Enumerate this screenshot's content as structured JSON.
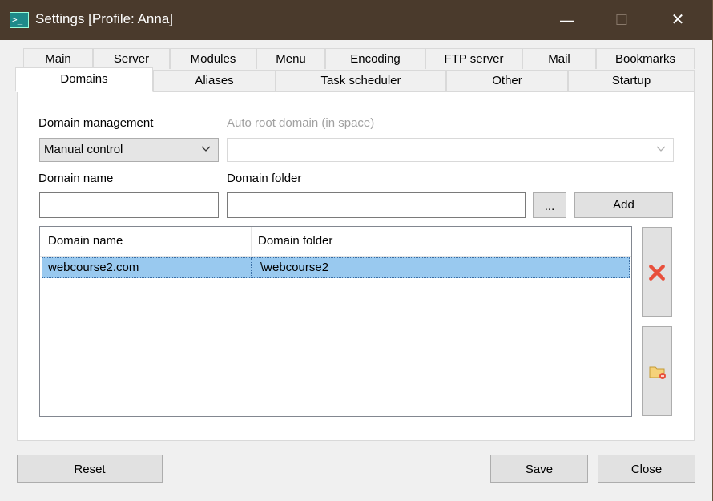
{
  "window": {
    "title": "Settings [Profile: Anna]",
    "controls": {
      "minimize": "—",
      "maximize": "☐",
      "close": "✕"
    }
  },
  "tabs": {
    "row1": [
      "Main",
      "Server",
      "Modules",
      "Menu",
      "Encoding",
      "FTP server",
      "Mail",
      "Bookmarks"
    ],
    "row2": [
      "Domains",
      "Aliases",
      "Task scheduler",
      "Other",
      "Startup"
    ],
    "active": "Domains"
  },
  "domains": {
    "management_label": "Domain management",
    "management_value": "Manual control",
    "auto_root_label": "Auto root domain (in space)",
    "auto_root_value": "",
    "name_label": "Domain name",
    "name_value": "",
    "folder_label": "Domain folder",
    "folder_value": "",
    "browse_label": "...",
    "add_label": "Add",
    "table": {
      "columns": [
        "Domain name",
        "Domain folder"
      ],
      "rows": [
        {
          "name": "webcourse2.com",
          "folder": "\\webcourse2",
          "selected": true
        }
      ]
    },
    "side_buttons": [
      "delete-icon",
      "folder-remove-icon"
    ]
  },
  "footer": {
    "reset_label": "Reset",
    "save_label": "Save",
    "close_label": "Close"
  },
  "colors": {
    "titlebar": "#4a3a2c",
    "selection": "#99c9ef",
    "delete_icon": "#e8503c"
  }
}
